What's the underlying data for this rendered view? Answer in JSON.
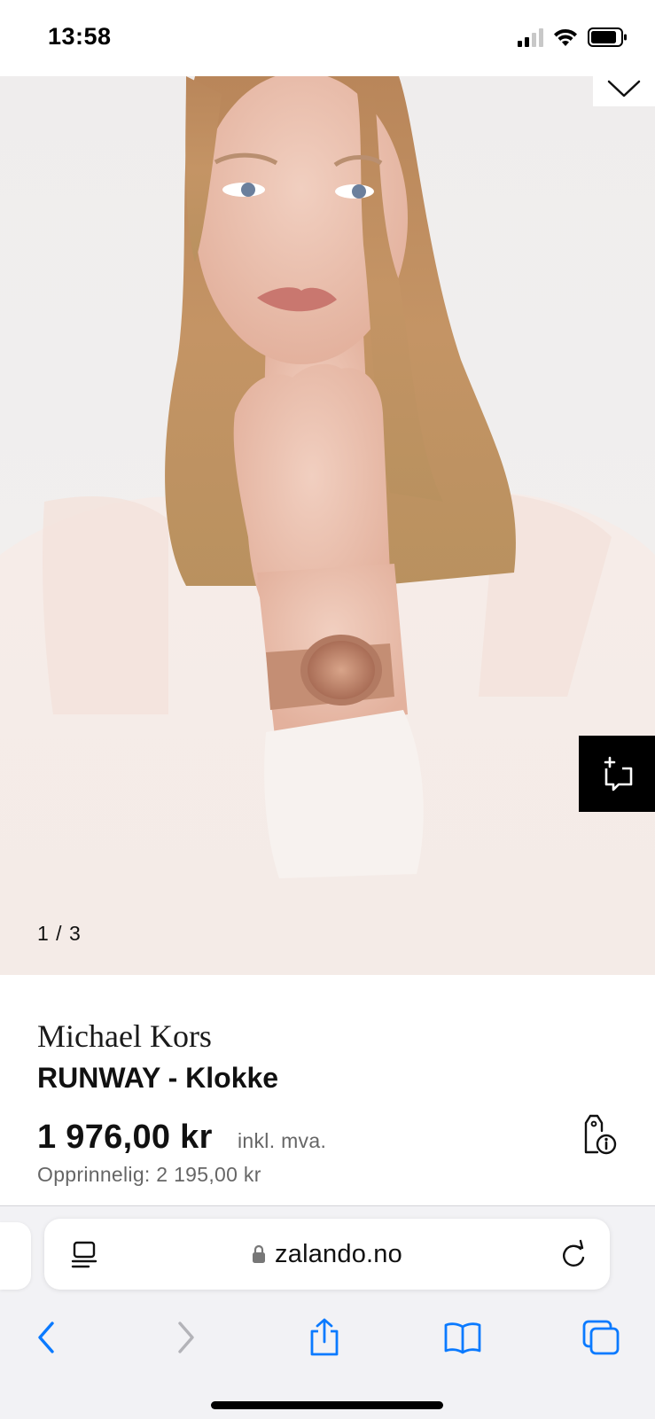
{
  "status_bar": {
    "time": "13:58",
    "icons": [
      "cellular-signal-icon",
      "wifi-icon",
      "battery-icon"
    ]
  },
  "gallery": {
    "counter": "1 / 3",
    "current_index": 1,
    "total_images": 3,
    "image_description_icon": "model-wearing-watch-photo",
    "share_icon": "add-to-share-icon",
    "collapse_icon": "chevron-down-icon"
  },
  "product": {
    "brand": "Michael Kors",
    "name": "RUNWAY - Klokke",
    "price": "1 976,00 kr",
    "vat_note": "inkl. mva.",
    "original_price": "Opprinnelig: 2 195,00 kr",
    "price_info_icon": "price-tag-info-icon"
  },
  "browser": {
    "url": "zalando.no",
    "reader_icon": "reader-mode-icon",
    "lock_icon": "lock-icon",
    "reload_icon": "reload-icon",
    "nav": [
      "back-icon",
      "forward-icon",
      "share-icon",
      "bookmarks-icon",
      "tabs-icon"
    ]
  },
  "colors": {
    "accent_blue": "#0a7aff",
    "disabled_gray": "#b3b3b8",
    "black": "#000000"
  }
}
